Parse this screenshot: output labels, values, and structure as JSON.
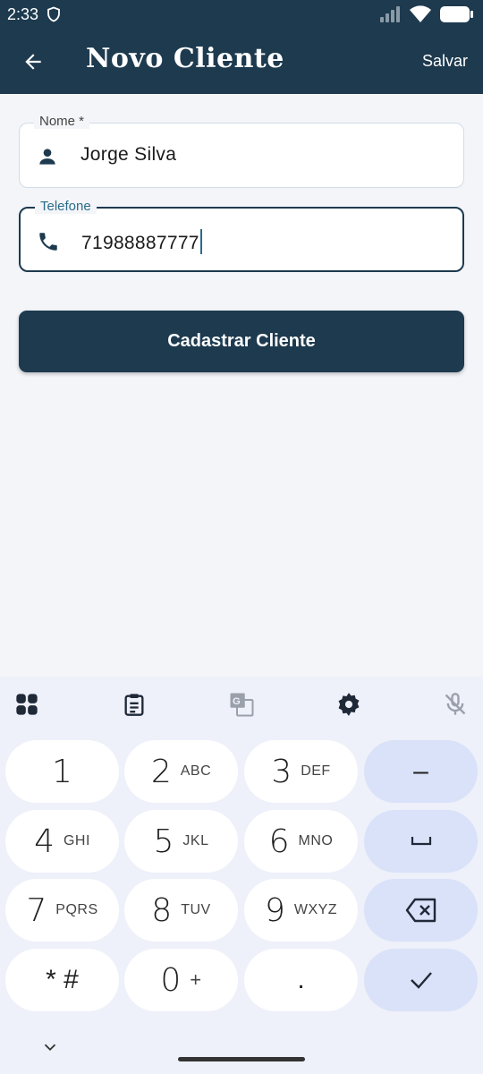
{
  "status_bar": {
    "time": "2:33",
    "icons": [
      "shield-icon",
      "signal-icon",
      "wifi-icon",
      "battery-icon"
    ]
  },
  "app_bar": {
    "title": "Novo Cliente",
    "save_label": "Salvar",
    "back_icon": "arrow-back-icon"
  },
  "form": {
    "name": {
      "label": "Nome *",
      "value": "Jorge Silva",
      "icon": "person-icon"
    },
    "phone": {
      "label": "Telefone",
      "value": "71988887777",
      "icon": "phone-icon"
    },
    "submit_label": "Cadastrar Cliente"
  },
  "keyboard": {
    "toolbar": [
      "apps-grid-icon",
      "clipboard-icon",
      "translate-icon",
      "settings-icon",
      "mic-off-icon"
    ],
    "keys": [
      {
        "digit": "1",
        "letters": ""
      },
      {
        "digit": "2",
        "letters": "ABC"
      },
      {
        "digit": "3",
        "letters": "DEF"
      },
      {
        "digit": "4",
        "letters": "GHI"
      },
      {
        "digit": "5",
        "letters": "JKL"
      },
      {
        "digit": "6",
        "letters": "MNO"
      },
      {
        "digit": "7",
        "letters": "PQRS"
      },
      {
        "digit": "8",
        "letters": "TUV"
      },
      {
        "digit": "9",
        "letters": "WXYZ"
      },
      {
        "digit": "* #",
        "letters": ""
      },
      {
        "digit": "0",
        "letters": "+"
      },
      {
        "digit": ".",
        "letters": ""
      }
    ],
    "actions": {
      "minus": "–",
      "space": "space-icon",
      "backspace": "backspace-icon",
      "done": "check-icon"
    }
  },
  "colors": {
    "primary": "#1d3a4f",
    "background": "#f4f5f9",
    "keyboard_bg": "#eef0fa",
    "action_key": "#d9e2f8",
    "accent": "#2c6c8a"
  }
}
